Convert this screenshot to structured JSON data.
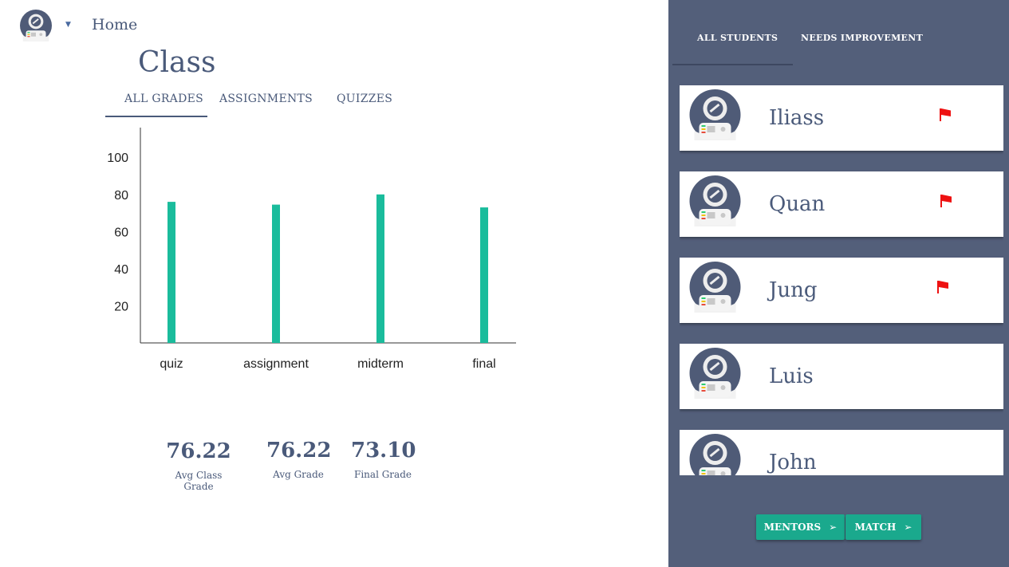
{
  "header": {
    "home_label": "Home",
    "page_title": "Class"
  },
  "tabs": [
    {
      "label": "ALL GRADES",
      "active": true
    },
    {
      "label": "ASSIGNMENTS",
      "active": false
    },
    {
      "label": "QUIZZES",
      "active": false
    }
  ],
  "chart_data": {
    "type": "bar",
    "categories": [
      "quiz",
      "assignment",
      "midterm",
      "final"
    ],
    "values": [
      76,
      74.5,
      80,
      73
    ],
    "yticks": [
      20,
      40,
      60,
      80,
      100
    ],
    "ylim": [
      0,
      116
    ],
    "color": "#1abc9c"
  },
  "stats": [
    {
      "value": "76.22",
      "label": "Avg Class Grade"
    },
    {
      "value": "76.22",
      "label": "Avg Grade"
    },
    {
      "value": "73.10",
      "label": "Final Grade"
    }
  ],
  "panel": {
    "tabs": [
      {
        "label": "ALL STUDENTS",
        "active": true
      },
      {
        "label": "NEEDS IMPROVEMENT",
        "active": false
      }
    ],
    "students": [
      {
        "name": "Iliass",
        "flagged": true
      },
      {
        "name": "Quan",
        "flagged": true
      },
      {
        "name": "Jung",
        "flagged": true
      },
      {
        "name": "Luis",
        "flagged": false
      },
      {
        "name": "John",
        "flagged": false
      }
    ],
    "buttons": {
      "mentors": "MENTORS",
      "match": "MATCH",
      "arrow": "➢"
    },
    "flag_color": "#ee1111"
  }
}
